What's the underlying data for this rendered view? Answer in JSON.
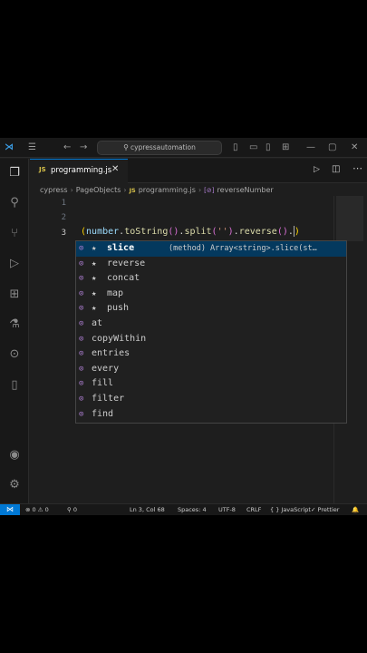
{
  "titlebar": {
    "search_text": "cypressautomation",
    "icons": [
      "vscode-logo",
      "menu-icon",
      "back-icon",
      "forward-icon",
      "search-icon",
      "layout-sidebar-icon",
      "layout-panel-icon",
      "layout-secondary-icon",
      "customize-layout-icon",
      "minimize-icon",
      "maximize-icon",
      "close-icon"
    ]
  },
  "activitybar": {
    "icons": [
      "explorer-icon",
      "search-icon",
      "source-control-icon",
      "run-debug-icon",
      "extensions-icon",
      "testing-icon",
      "remote-icon",
      "notebook-icon",
      "account-icon",
      "settings-icon"
    ]
  },
  "tabs": [
    {
      "badge": "JS",
      "label": "programming.js",
      "close": "✕",
      "active": true
    }
  ],
  "breadcrumb": {
    "items": [
      "cypress",
      "PageObjects",
      "programming.js",
      "reverseNumber"
    ],
    "file_badge": "JS",
    "symbol_badge": "[⊘]"
  },
  "editor": {
    "line_numbers": [
      "1",
      "2",
      "3"
    ],
    "code": {
      "open_paren": "(",
      "var": "number",
      "dot1": ".",
      "fn1": "toString",
      "p1": "()",
      "dot2": ".",
      "fn2": "split",
      "p2a": "(",
      "str": "''",
      "p2b": ")",
      "dot3": ".",
      "fn3": "reverse",
      "p3": "()",
      "dot4": ".",
      "close_paren": ")"
    }
  },
  "suggest": {
    "items": [
      {
        "label": "slice",
        "starred": true,
        "selected": true,
        "detail": "(method) Array<string>.slice(st…"
      },
      {
        "label": "reverse",
        "starred": true,
        "selected": false,
        "detail": ""
      },
      {
        "label": "concat",
        "starred": true,
        "selected": false,
        "detail": ""
      },
      {
        "label": "map",
        "starred": true,
        "selected": false,
        "detail": ""
      },
      {
        "label": "push",
        "starred": true,
        "selected": false,
        "detail": ""
      },
      {
        "label": "at",
        "starred": false,
        "selected": false,
        "detail": ""
      },
      {
        "label": "copyWithin",
        "starred": false,
        "selected": false,
        "detail": ""
      },
      {
        "label": "entries",
        "starred": false,
        "selected": false,
        "detail": ""
      },
      {
        "label": "every",
        "starred": false,
        "selected": false,
        "detail": ""
      },
      {
        "label": "fill",
        "starred": false,
        "selected": false,
        "detail": ""
      },
      {
        "label": "filter",
        "starred": false,
        "selected": false,
        "detail": ""
      },
      {
        "label": "find",
        "starred": false,
        "selected": false,
        "detail": ""
      }
    ]
  },
  "statusbar": {
    "remote": "⋈",
    "problems": "⊗ 0 ⚠ 0",
    "ports": "⚲ 0",
    "position": "Ln 3, Col 68",
    "spaces": "Spaces: 4",
    "encoding": "UTF-8",
    "eol": "CRLF",
    "language": "{ } JavaScript",
    "formatter": "✓ Prettier",
    "notifications": "🔔"
  },
  "colors": {
    "accent": "#0078d4",
    "selection": "#04395e",
    "method_icon": "#b180d7",
    "js_badge": "#d8c24a"
  }
}
